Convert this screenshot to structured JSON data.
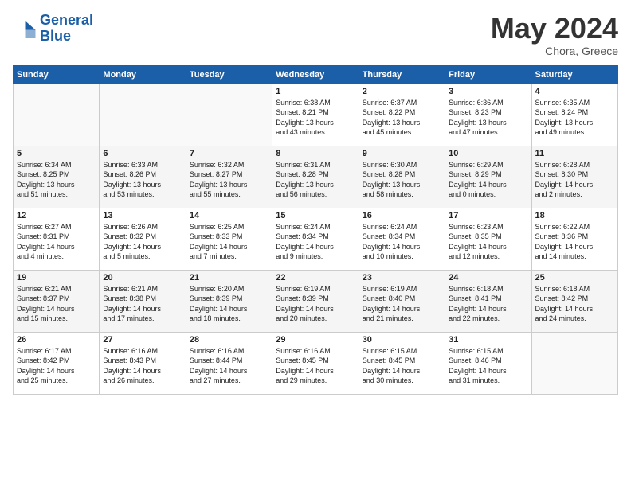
{
  "header": {
    "logo_general": "General",
    "logo_blue": "Blue",
    "month": "May 2024",
    "location": "Chora, Greece"
  },
  "weekdays": [
    "Sunday",
    "Monday",
    "Tuesday",
    "Wednesday",
    "Thursday",
    "Friday",
    "Saturday"
  ],
  "weeks": [
    [
      {
        "day": "",
        "info": ""
      },
      {
        "day": "",
        "info": ""
      },
      {
        "day": "",
        "info": ""
      },
      {
        "day": "1",
        "info": "Sunrise: 6:38 AM\nSunset: 8:21 PM\nDaylight: 13 hours\nand 43 minutes."
      },
      {
        "day": "2",
        "info": "Sunrise: 6:37 AM\nSunset: 8:22 PM\nDaylight: 13 hours\nand 45 minutes."
      },
      {
        "day": "3",
        "info": "Sunrise: 6:36 AM\nSunset: 8:23 PM\nDaylight: 13 hours\nand 47 minutes."
      },
      {
        "day": "4",
        "info": "Sunrise: 6:35 AM\nSunset: 8:24 PM\nDaylight: 13 hours\nand 49 minutes."
      }
    ],
    [
      {
        "day": "5",
        "info": "Sunrise: 6:34 AM\nSunset: 8:25 PM\nDaylight: 13 hours\nand 51 minutes."
      },
      {
        "day": "6",
        "info": "Sunrise: 6:33 AM\nSunset: 8:26 PM\nDaylight: 13 hours\nand 53 minutes."
      },
      {
        "day": "7",
        "info": "Sunrise: 6:32 AM\nSunset: 8:27 PM\nDaylight: 13 hours\nand 55 minutes."
      },
      {
        "day": "8",
        "info": "Sunrise: 6:31 AM\nSunset: 8:28 PM\nDaylight: 13 hours\nand 56 minutes."
      },
      {
        "day": "9",
        "info": "Sunrise: 6:30 AM\nSunset: 8:28 PM\nDaylight: 13 hours\nand 58 minutes."
      },
      {
        "day": "10",
        "info": "Sunrise: 6:29 AM\nSunset: 8:29 PM\nDaylight: 14 hours\nand 0 minutes."
      },
      {
        "day": "11",
        "info": "Sunrise: 6:28 AM\nSunset: 8:30 PM\nDaylight: 14 hours\nand 2 minutes."
      }
    ],
    [
      {
        "day": "12",
        "info": "Sunrise: 6:27 AM\nSunset: 8:31 PM\nDaylight: 14 hours\nand 4 minutes."
      },
      {
        "day": "13",
        "info": "Sunrise: 6:26 AM\nSunset: 8:32 PM\nDaylight: 14 hours\nand 5 minutes."
      },
      {
        "day": "14",
        "info": "Sunrise: 6:25 AM\nSunset: 8:33 PM\nDaylight: 14 hours\nand 7 minutes."
      },
      {
        "day": "15",
        "info": "Sunrise: 6:24 AM\nSunset: 8:34 PM\nDaylight: 14 hours\nand 9 minutes."
      },
      {
        "day": "16",
        "info": "Sunrise: 6:24 AM\nSunset: 8:34 PM\nDaylight: 14 hours\nand 10 minutes."
      },
      {
        "day": "17",
        "info": "Sunrise: 6:23 AM\nSunset: 8:35 PM\nDaylight: 14 hours\nand 12 minutes."
      },
      {
        "day": "18",
        "info": "Sunrise: 6:22 AM\nSunset: 8:36 PM\nDaylight: 14 hours\nand 14 minutes."
      }
    ],
    [
      {
        "day": "19",
        "info": "Sunrise: 6:21 AM\nSunset: 8:37 PM\nDaylight: 14 hours\nand 15 minutes."
      },
      {
        "day": "20",
        "info": "Sunrise: 6:21 AM\nSunset: 8:38 PM\nDaylight: 14 hours\nand 17 minutes."
      },
      {
        "day": "21",
        "info": "Sunrise: 6:20 AM\nSunset: 8:39 PM\nDaylight: 14 hours\nand 18 minutes."
      },
      {
        "day": "22",
        "info": "Sunrise: 6:19 AM\nSunset: 8:39 PM\nDaylight: 14 hours\nand 20 minutes."
      },
      {
        "day": "23",
        "info": "Sunrise: 6:19 AM\nSunset: 8:40 PM\nDaylight: 14 hours\nand 21 minutes."
      },
      {
        "day": "24",
        "info": "Sunrise: 6:18 AM\nSunset: 8:41 PM\nDaylight: 14 hours\nand 22 minutes."
      },
      {
        "day": "25",
        "info": "Sunrise: 6:18 AM\nSunset: 8:42 PM\nDaylight: 14 hours\nand 24 minutes."
      }
    ],
    [
      {
        "day": "26",
        "info": "Sunrise: 6:17 AM\nSunset: 8:42 PM\nDaylight: 14 hours\nand 25 minutes."
      },
      {
        "day": "27",
        "info": "Sunrise: 6:16 AM\nSunset: 8:43 PM\nDaylight: 14 hours\nand 26 minutes."
      },
      {
        "day": "28",
        "info": "Sunrise: 6:16 AM\nSunset: 8:44 PM\nDaylight: 14 hours\nand 27 minutes."
      },
      {
        "day": "29",
        "info": "Sunrise: 6:16 AM\nSunset: 8:45 PM\nDaylight: 14 hours\nand 29 minutes."
      },
      {
        "day": "30",
        "info": "Sunrise: 6:15 AM\nSunset: 8:45 PM\nDaylight: 14 hours\nand 30 minutes."
      },
      {
        "day": "31",
        "info": "Sunrise: 6:15 AM\nSunset: 8:46 PM\nDaylight: 14 hours\nand 31 minutes."
      },
      {
        "day": "",
        "info": ""
      }
    ]
  ]
}
